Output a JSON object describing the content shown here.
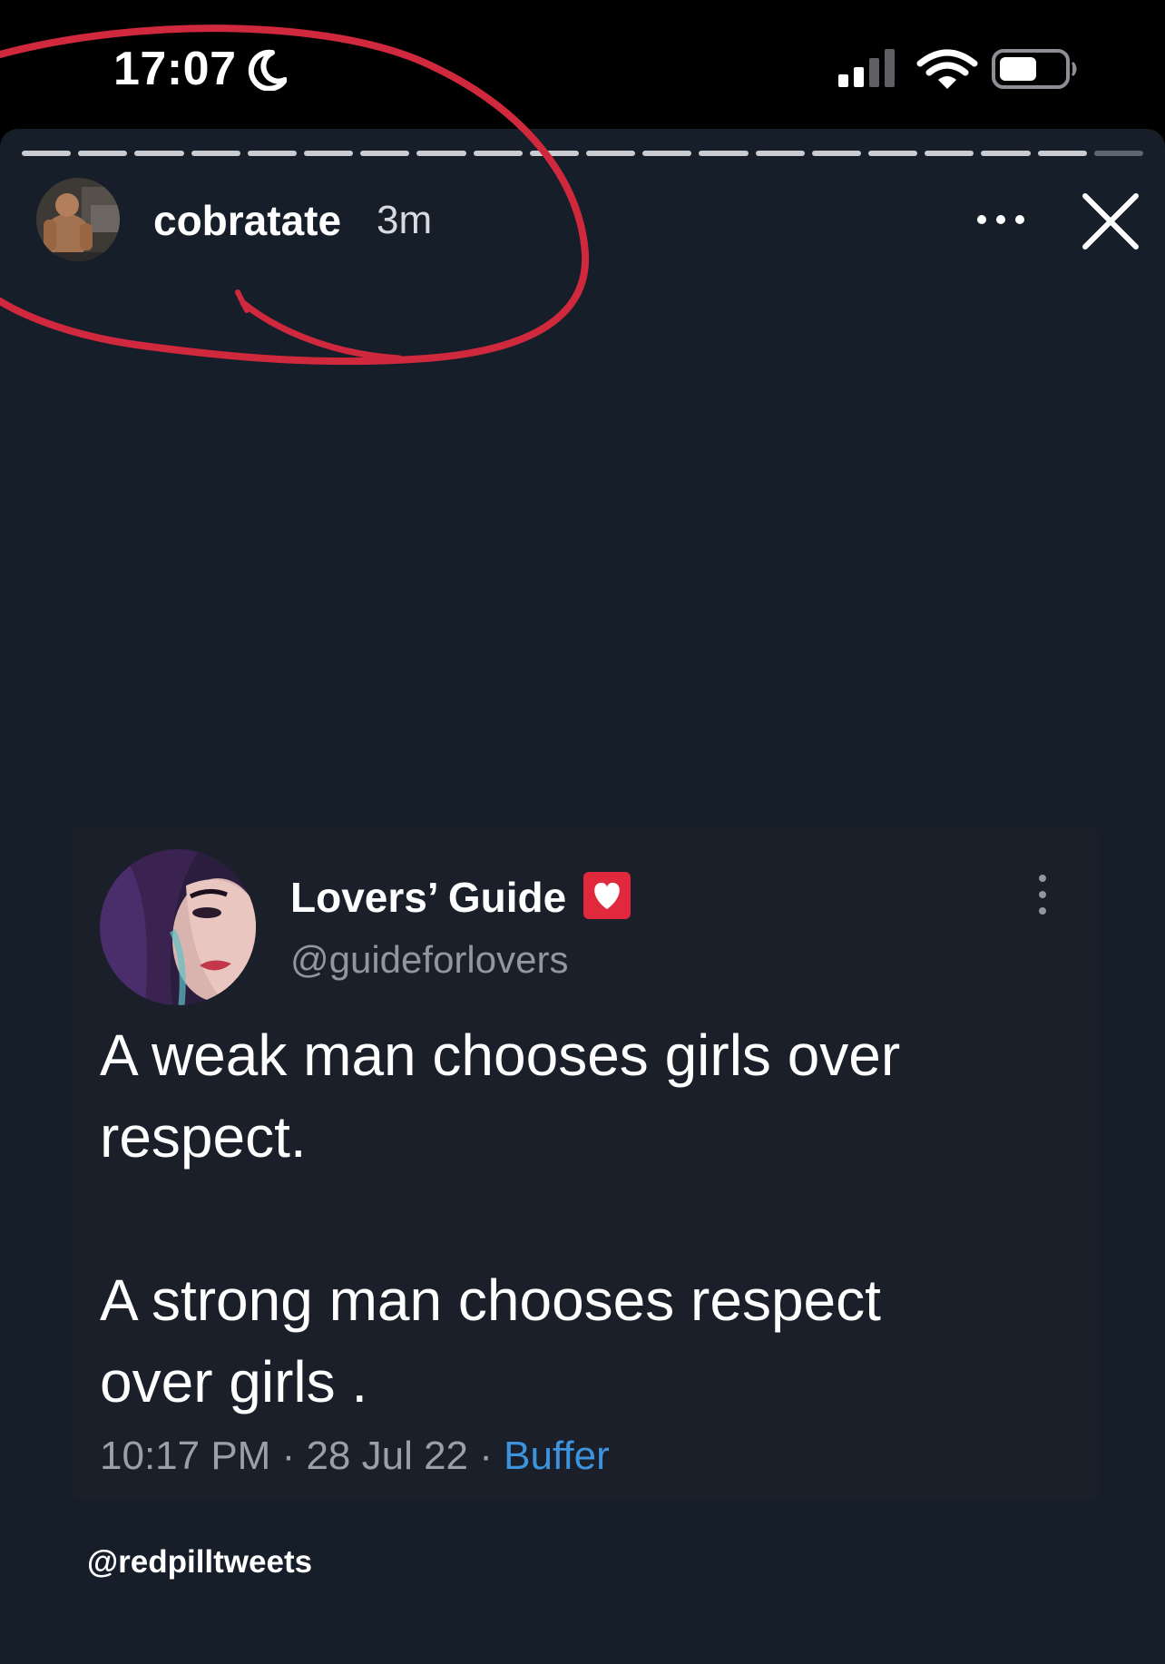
{
  "status_bar": {
    "time": "17:07"
  },
  "story": {
    "username": "cobratate",
    "age": "3m",
    "segments_total": 20,
    "segments_viewed": 19
  },
  "tweet": {
    "display_name": "Lovers’ Guide",
    "handle": "@guideforlovers",
    "lines": [
      "A weak man chooses girls over",
      "respect.",
      "",
      "A strong man chooses respect",
      "over girls ."
    ],
    "time": "10:17 PM",
    "date": "28 Jul 22",
    "separator": " · ",
    "source": "Buffer"
  },
  "watermark": "@redpilltweets",
  "colors": {
    "story_background": "#161e2a",
    "tweet_card": "#1a1f29",
    "source_link": "#3b94dd",
    "annotation": "#d0283c",
    "badge": "#e0293d"
  },
  "icons": [
    "moon-icon",
    "signal-icon",
    "wifi-icon",
    "battery-icon",
    "more-icon",
    "close-icon",
    "heart-icon",
    "vertical-dots-icon"
  ]
}
